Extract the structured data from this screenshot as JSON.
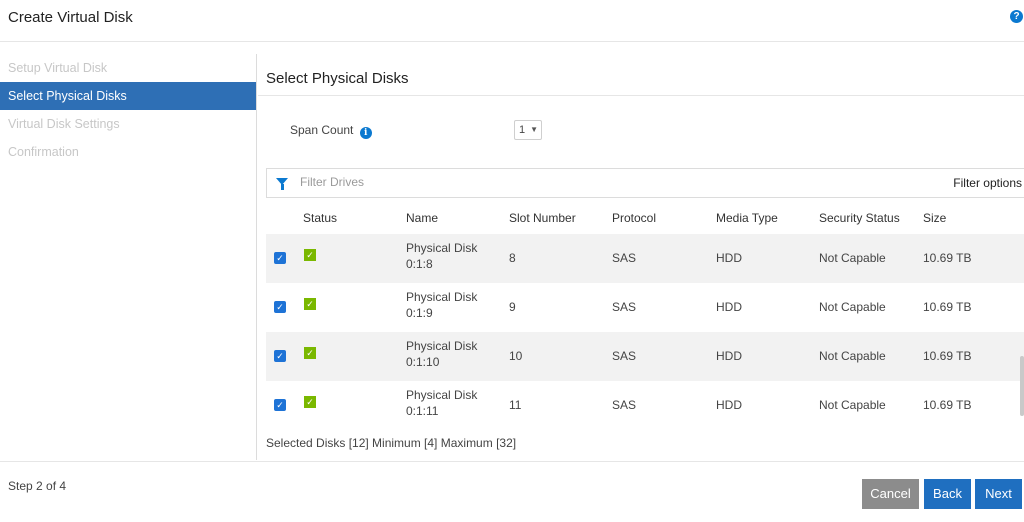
{
  "header": {
    "title": "Create Virtual Disk",
    "help_glyph": "?"
  },
  "wizard_steps": [
    {
      "label": "Setup Virtual Disk",
      "state": "disabled"
    },
    {
      "label": "Select Physical Disks",
      "state": "active"
    },
    {
      "label": "Virtual Disk Settings",
      "state": "disabled"
    },
    {
      "label": "Confirmation",
      "state": "disabled"
    }
  ],
  "main": {
    "title": "Select Physical Disks",
    "span_count": {
      "label": "Span Count",
      "value": "1",
      "info_glyph": "i"
    },
    "filter": {
      "placeholder": "Filter Drives",
      "value": "",
      "options_label": "Filter options"
    },
    "table": {
      "columns": [
        "Status",
        "Name",
        "Slot Number",
        "Protocol",
        "Media Type",
        "Security Status",
        "Size"
      ],
      "rows": [
        {
          "checked": true,
          "status": "ok",
          "name_line1": "Physical Disk",
          "name_line2": "0:1:8",
          "slot": "8",
          "protocol": "SAS",
          "media_type": "HDD",
          "security_status": "Not Capable",
          "size": "10.69 TB"
        },
        {
          "checked": true,
          "status": "ok",
          "name_line1": "Physical Disk",
          "name_line2": "0:1:9",
          "slot": "9",
          "protocol": "SAS",
          "media_type": "HDD",
          "security_status": "Not Capable",
          "size": "10.69 TB"
        },
        {
          "checked": true,
          "status": "ok",
          "name_line1": "Physical Disk",
          "name_line2": "0:1:10",
          "slot": "10",
          "protocol": "SAS",
          "media_type": "HDD",
          "security_status": "Not Capable",
          "size": "10.69 TB"
        },
        {
          "checked": true,
          "status": "ok",
          "name_line1": "Physical Disk",
          "name_line2": "0:1:11",
          "slot": "11",
          "protocol": "SAS",
          "media_type": "HDD",
          "security_status": "Not Capable",
          "size": "10.69 TB"
        }
      ]
    },
    "selection_summary": "Selected Disks [12] Minimum [4] Maximum [32]"
  },
  "footer": {
    "step_indicator": "Step 2 of 4",
    "buttons": {
      "cancel": "Cancel",
      "back": "Back",
      "next": "Next"
    }
  },
  "icons": {
    "help": "help-circle-icon",
    "info": "info-circle-icon",
    "filter": "funnel-icon",
    "checkbox": "checkbox-checked-icon",
    "status": "status-ok-icon"
  },
  "colors": {
    "active_step": "#2e6fb5",
    "primary_button": "#1f6fc0",
    "cancel_button": "#8c8c8c",
    "status_ok": "#7ab800",
    "checkbox": "#1e73d6",
    "info": "#0b79d0"
  }
}
